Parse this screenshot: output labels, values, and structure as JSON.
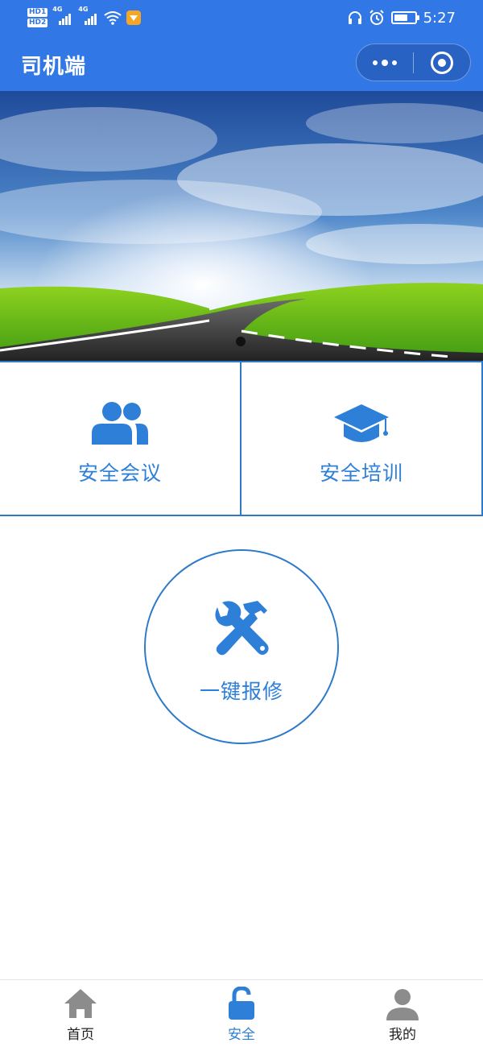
{
  "status_bar": {
    "hd_labels": [
      "HD1",
      "HD2"
    ],
    "network_1": "4G",
    "network_2": "4G",
    "time": "5:27"
  },
  "header": {
    "title": "司机端"
  },
  "banner": {
    "slide_count": 1,
    "active_slide": 1
  },
  "menu": {
    "items": [
      {
        "label": "安全会议",
        "icon": "users-icon"
      },
      {
        "label": "安全培训",
        "icon": "graduation-cap-icon"
      }
    ]
  },
  "repair": {
    "label": "一键报修",
    "icon": "hammer-wrench-icon"
  },
  "tabbar": {
    "tabs": [
      {
        "label": "首页",
        "icon": "home-icon",
        "active": false
      },
      {
        "label": "安全",
        "icon": "lock-open-icon",
        "active": true
      },
      {
        "label": "我的",
        "icon": "user-icon",
        "active": false
      }
    ]
  },
  "colors": {
    "header_bg": "#3178e6",
    "accent": "#2d7fd8",
    "border": "#2c7ac9",
    "inactive_icon": "#8c8c8c"
  }
}
